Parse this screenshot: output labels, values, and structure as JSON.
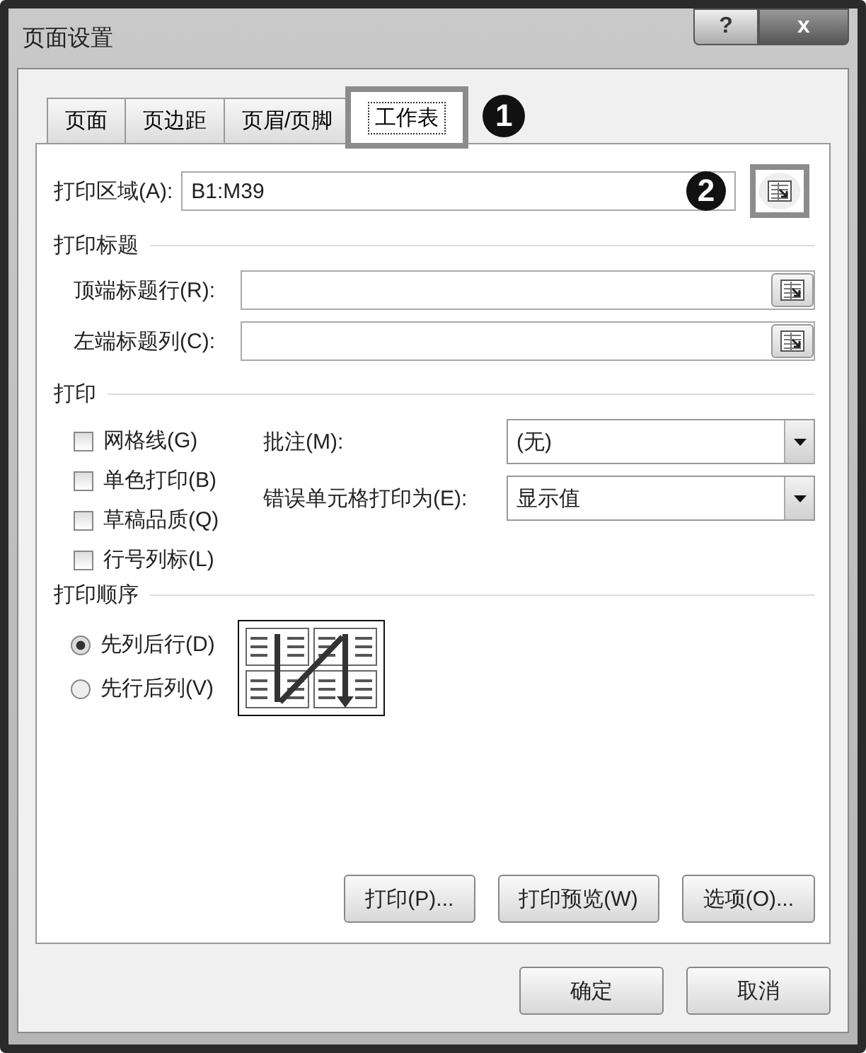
{
  "window": {
    "title": "页面设置",
    "help_button": "?",
    "close_button": "x"
  },
  "tabs": [
    {
      "label": "页面",
      "selected": false,
      "highlighted": false
    },
    {
      "label": "页边距",
      "selected": false,
      "highlighted": false
    },
    {
      "label": "页眉/页脚",
      "selected": false,
      "highlighted": false
    },
    {
      "label": "工作表",
      "selected": true,
      "highlighted": true
    }
  ],
  "tabs_callout": "1",
  "print_area": {
    "label": "打印区域(A):",
    "value": "B1:M39",
    "callout": "2",
    "picker_highlighted": true
  },
  "print_titles": {
    "heading": "打印标题",
    "rows": [
      {
        "label": "顶端标题行(R):"
      },
      {
        "label": "左端标题列(C):"
      }
    ]
  },
  "print": {
    "heading": "打印",
    "checkboxes": [
      {
        "label": "网格线(G)",
        "checked": false
      },
      {
        "label": "单色打印(B)",
        "checked": false
      },
      {
        "label": "草稿品质(Q)",
        "checked": false
      },
      {
        "label": "行号列标(L)",
        "checked": false
      }
    ],
    "dropdowns": [
      {
        "label": "批注(M):",
        "value": "(无)"
      },
      {
        "label": "错误单元格打印为(E):",
        "value": "显示值"
      }
    ]
  },
  "order": {
    "heading": "打印顺序",
    "options": [
      {
        "label": "先列后行(D)",
        "selected": true
      },
      {
        "label": "先行后列(V)",
        "selected": false
      }
    ]
  },
  "actions": [
    "打印(P)...",
    "打印预览(W)",
    "选项(O)..."
  ],
  "footer_buttons": [
    "确定",
    "取消"
  ]
}
